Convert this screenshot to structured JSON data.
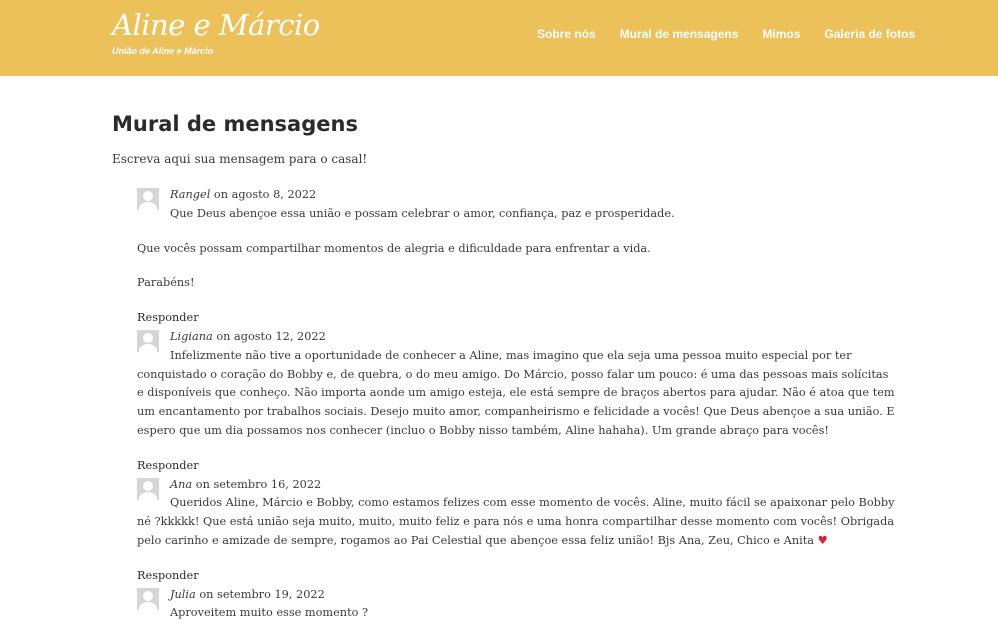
{
  "header": {
    "site_title": "Aline e Márcio",
    "tagline": "União de Aline e Márcio",
    "nav": [
      "Sobre nós",
      "Mural de mensagens",
      "Mimos",
      "Galeria de fotos"
    ]
  },
  "page": {
    "title": "Mural de mensagens",
    "intro": "Escreva aqui sua mensagem para o casal!"
  },
  "on_label": "on",
  "reply_label": "Responder",
  "comments": [
    {
      "author": "Rangel",
      "date": "agosto 8, 2022",
      "paragraphs": [
        "Que Deus abençoe essa união e possam celebrar o amor, confiança, paz e prosperidade.",
        "Que vocês possam compartilhar momentos de alegria e dificuldade para enfrentar a vida.",
        "Parabéns!"
      ]
    },
    {
      "author": "Ligiana",
      "date": "agosto 12, 2022",
      "paragraphs": [
        "Infelizmente não tive a oportunidade de conhecer a Aline, mas imagino que ela seja uma pessoa muito especial por ter conquistado o coração do Bobby e, de quebra, o do meu amigo. Do Márcio, posso falar um pouco: é uma das pessoas mais solícitas e disponíveis que conheço. Não importa aonde um amigo esteja, ele está sempre de braços abertos para ajudar. Não é atoa que tem um encantamento por trabalhos sociais. Desejo muito amor, companheirismo e felicidade a vocês! Que Deus abençoe a sua união. E espero que um dia possamos nos conhecer (incluo o Bobby nisso também, Aline hahaha). Um grande abraço para vocês!"
      ]
    },
    {
      "author": "Ana",
      "date": "setembro 16, 2022",
      "paragraphs": [
        "Queridos Aline, Márcio e Bobby, como estamos felizes com esse momento de vocês. Aline, muito fácil se apaixonar pelo Bobby né ?kkkkk! Que está união seja muito, muito, muito feliz e para nós e uma honra compartilhar desse momento com vocês! Obrigada pelo carinho e amizade de sempre, rogamos ao Pai Celestial que abençoe essa feliz união! Bjs Ana, Zeu, Chico e Anita"
      ],
      "emoji": "♥"
    },
    {
      "author": "Julia",
      "date": "setembro 19, 2022",
      "paragraphs": [
        "Aproveitem muito esse momento ?"
      ]
    }
  ],
  "colors": {
    "header_bg": "#ecc15a",
    "heart": "#d9223b"
  }
}
